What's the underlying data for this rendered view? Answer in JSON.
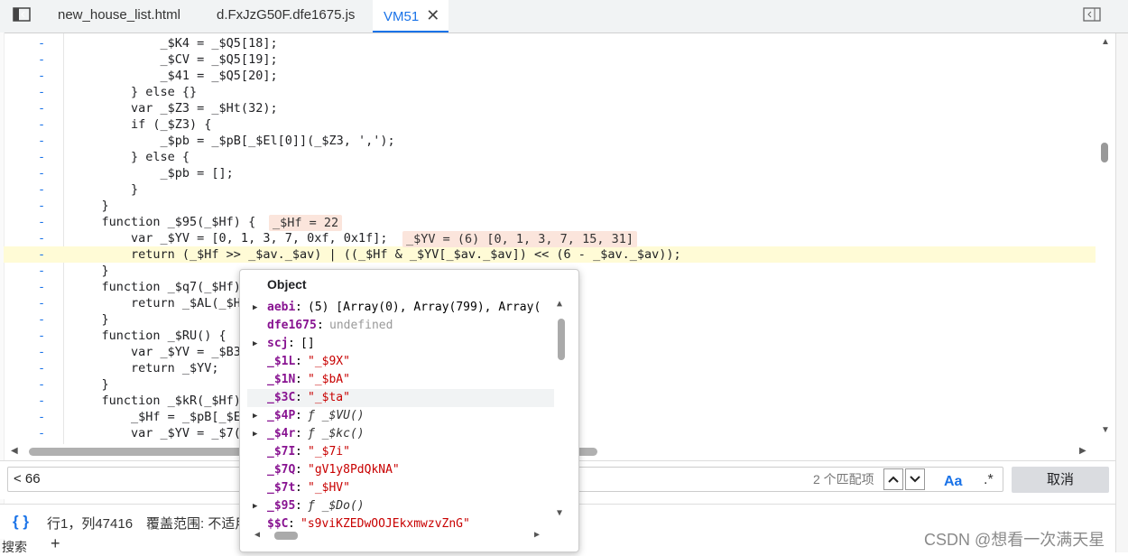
{
  "tabs": [
    {
      "label": "new_house_list.html",
      "active": false
    },
    {
      "label": "d.FxJzG50F.dfe1675.js",
      "active": false
    },
    {
      "label": "VM51",
      "active": true
    }
  ],
  "gutter_marker": "-",
  "code_lines": [
    {
      "text": "            _$K4 = _$Q5[18];"
    },
    {
      "text": "            _$CV = _$Q5[19];"
    },
    {
      "text": "            _$41 = _$Q5[20];"
    },
    {
      "text": "        } else {}"
    },
    {
      "text": "        var _$Z3 = _$Ht(32);"
    },
    {
      "text": "        if (_$Z3) {"
    },
    {
      "text": "            _$pb = _$pB[_$El[0]](_$Z3, ',');"
    },
    {
      "text": "        } else {"
    },
    {
      "text": "            _$pb = [];"
    },
    {
      "text": "        }"
    },
    {
      "text": "    }"
    },
    {
      "text": "    function _$95(_$Hf) {"
    },
    {
      "text": "        var _$YV = [0, 1, 3, 7, 0xf, 0x1f];"
    },
    {
      "text": "        return (_$Hf >> _$av._$av) | ((_$Hf & _$YV[_$av._$av]) << (6 - _$av._$av));"
    },
    {
      "text": "    }"
    },
    {
      "text": "    function _$q7(_$Hf) {"
    },
    {
      "text": "        return _$AL(_$Hf"
    },
    {
      "text": "    }"
    },
    {
      "text": "    function _$RU() {"
    },
    {
      "text": "        var _$YV = _$B3"
    },
    {
      "text": "        return _$YV;"
    },
    {
      "text": "    }"
    },
    {
      "text": "    function _$kR(_$Hf)"
    },
    {
      "text": "        _$Hf = _$pB[_$E"
    },
    {
      "text": "        var _$YV = _$7("
    }
  ],
  "inline_values": [
    {
      "text": "_$Hf = 22"
    },
    {
      "text": "_$YV = (6) [0, 1, 3, 7, 15, 31]"
    }
  ],
  "popover": {
    "title": "Object",
    "properties": [
      {
        "key": "aebi",
        "value": "(5) [Array(0), Array(799), Array(",
        "kind": "arr",
        "expandable": true
      },
      {
        "key": "dfe1675",
        "value": "undefined",
        "kind": "nul",
        "expandable": false
      },
      {
        "key": "scj",
        "value": "[]",
        "kind": "plain",
        "expandable": true
      },
      {
        "key": "_$1L",
        "value": "\"_$9X\"",
        "kind": "str",
        "expandable": false
      },
      {
        "key": "_$1N",
        "value": "\"_$bA\"",
        "kind": "str",
        "expandable": false
      },
      {
        "key": "_$3C",
        "value": "\"_$ta\"",
        "kind": "str",
        "expandable": false
      },
      {
        "key": "_$4P",
        "value": "ƒ _$VU()",
        "kind": "fn",
        "expandable": true
      },
      {
        "key": "_$4r",
        "value": "ƒ _$kc()",
        "kind": "fn",
        "expandable": true
      },
      {
        "key": "_$7I",
        "value": "\"_$7i\"",
        "kind": "str",
        "expandable": false
      },
      {
        "key": "_$7Q",
        "value": "\"gV1y8PdQkNA\"",
        "kind": "str",
        "expandable": false
      },
      {
        "key": "_$7t",
        "value": "\"_$HV\"",
        "kind": "str",
        "expandable": false
      },
      {
        "key": "_$95",
        "value": "ƒ _$Do()",
        "kind": "fn",
        "expandable": true
      },
      {
        "key": "$$C",
        "value": "\"s9viKZEDwOOJEkxmwzvZnG\"",
        "kind": "str",
        "expandable": false
      }
    ]
  },
  "search": {
    "value": "< 66",
    "match_count": "2 个匹配项",
    "case_label": "Aa",
    "regex_label": ".*",
    "cancel_label": "取消"
  },
  "status": {
    "braces": "{ }",
    "position": "行1，列47416",
    "coverage": "覆盖范围: 不适用"
  },
  "bottom": {
    "label": "搜索",
    "plus": "+"
  },
  "watermark": "CSDN @想看一次满天星"
}
